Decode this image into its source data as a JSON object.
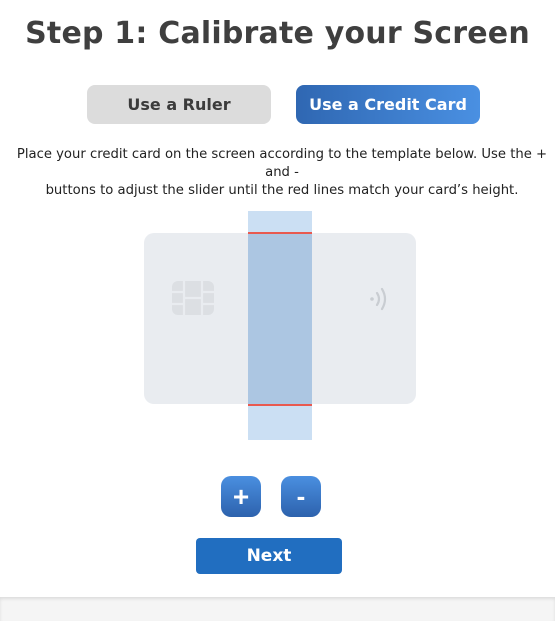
{
  "page": {
    "title": "Step 1: Calibrate your Screen"
  },
  "mode_toggle": {
    "ruler_label": "Use a Ruler",
    "card_label": "Use a Credit Card",
    "selected": "Use a Credit Card"
  },
  "instructions": {
    "line1": "Place your credit card on the screen according to the template below. Use the + and -",
    "line2": "buttons to adjust the slider until the red lines match your card’s height."
  },
  "card_template": {
    "chip_icon": "chip-icon",
    "contactless_icon": "contactless-icon"
  },
  "controls": {
    "plus_label": "+",
    "minus_label": "-",
    "next_label": "Next"
  },
  "colors": {
    "accent": "#216ec0",
    "gradient_start": "#2f67b2",
    "gradient_end": "#4a90e2",
    "red_line": "#e8594f",
    "inactive_button": "#dcdcdc",
    "card": "#e9ecf0"
  }
}
